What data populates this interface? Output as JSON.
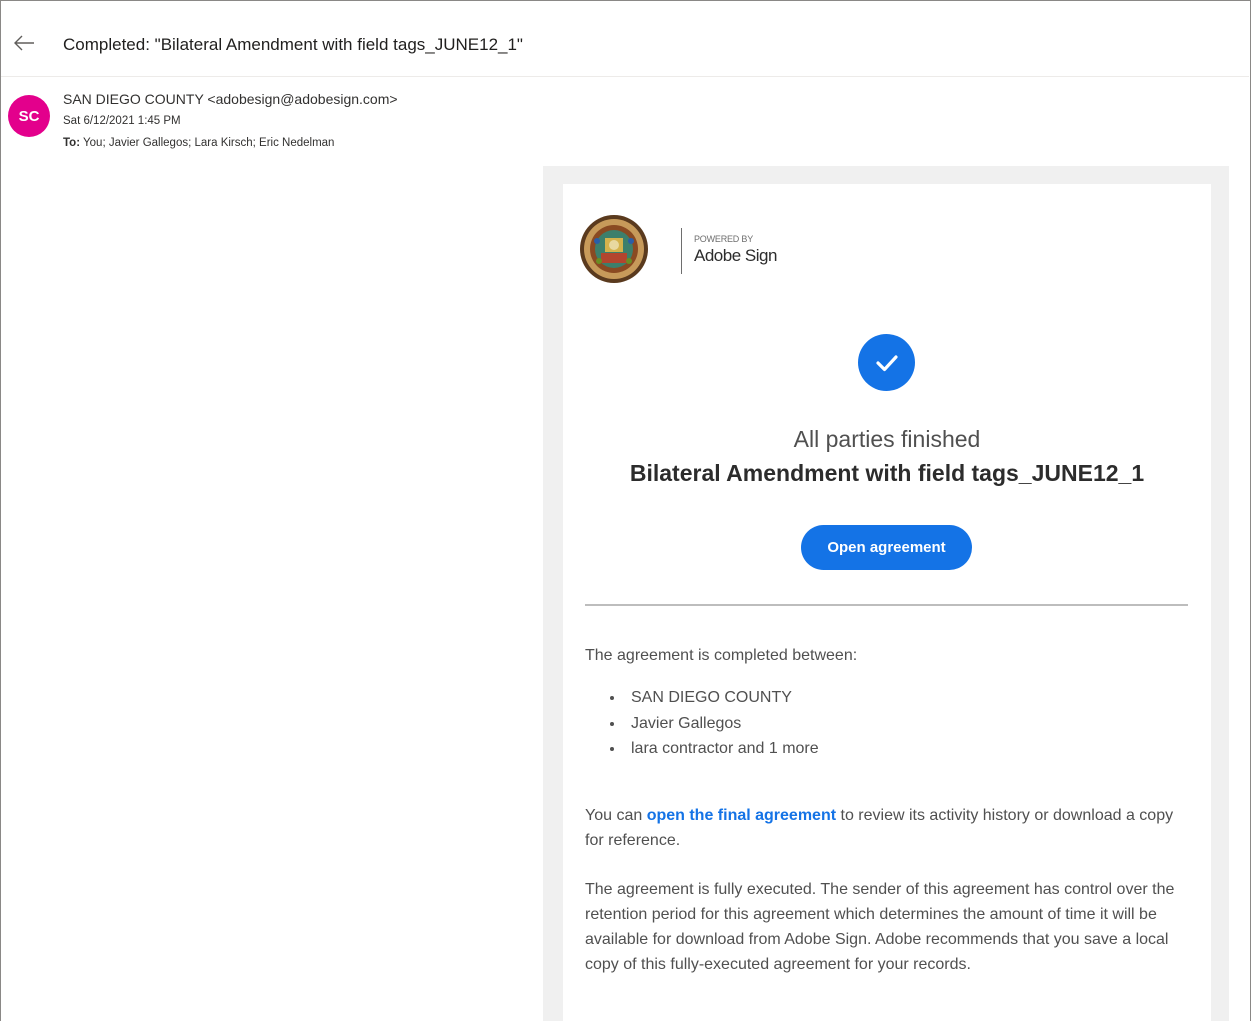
{
  "header": {
    "subject": "Completed: \"Bilateral Amendment with field tags_JUNE12_1\""
  },
  "message": {
    "avatar_initials": "SC",
    "avatar_color": "#e3008c",
    "sender": "SAN DIEGO COUNTY <adobesign@adobesign.com>",
    "date": "Sat 6/12/2021 1:45 PM",
    "to_label": "To:",
    "recipients": "You; Javier Gallegos; Lara Kirsch; Eric Nedelman"
  },
  "email": {
    "powered_by": "POWERED BY",
    "brand": "Adobe Sign",
    "status": "All parties finished",
    "agreement_title": "Bilateral Amendment with field tags_JUNE12_1",
    "open_button": "Open agreement",
    "intro": "The agreement is completed between:",
    "parties": [
      "SAN DIEGO COUNTY",
      "Javier Gallegos",
      "lara contractor and 1 more"
    ],
    "para1_before": "You can ",
    "para1_link": "open the final agreement",
    "para1_after": " to review its activity history or download a copy for reference.",
    "para2": "The agreement is fully executed. The sender of this agreement has control over the retention period for this agreement which determines the amount of time it will be available for download from Adobe Sign. Adobe recommends that you save a local copy of this fully-executed agreement for your records.",
    "accent_color": "#1473e6"
  },
  "icons": {
    "back": "arrow-left-icon",
    "check": "checkmark-icon",
    "seal": "county-seal-logo"
  }
}
